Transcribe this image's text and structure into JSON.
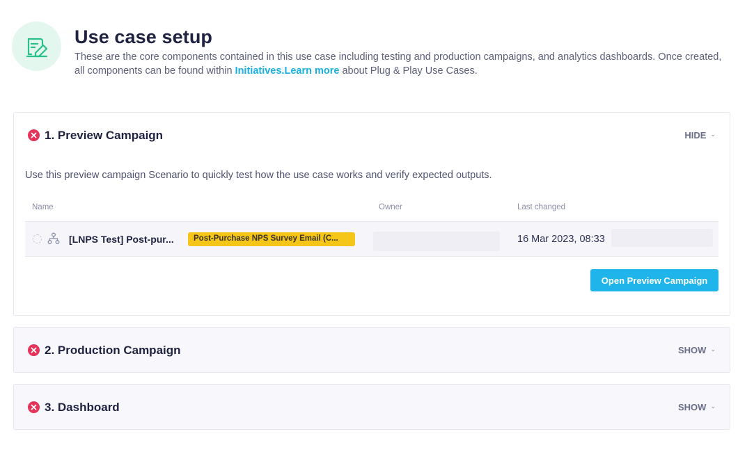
{
  "header": {
    "icon": "document-edit-icon",
    "title": "Use case setup",
    "desc_part1": "These are the core components contained in this use case including testing and production campaigns, and analytics dashboards. Once created, all components can be found within ",
    "initiatives_link": "Initiatives.",
    "learn_more_link": "Learn more",
    "desc_part2": " about Plug & Play Use Cases."
  },
  "panels": [
    {
      "title": "1. Preview Campaign",
      "toggle_label": "HIDE",
      "status_icon": "error-x-icon",
      "status_color": "#e5335a",
      "description": "Use this preview campaign Scenario to quickly test how the use case works and verify expected outputs.",
      "columns": {
        "name": "Name",
        "owner": "Owner",
        "last_changed": "Last changed"
      },
      "rows": [
        {
          "name": "[LNPS Test] Post-pur...",
          "badge": "Post-Purchase NPS Survey Email (C...",
          "owner": "",
          "last_changed": "16 Mar 2023, 08:33"
        }
      ],
      "action_label": "Open Preview Campaign"
    },
    {
      "title": "2. Production Campaign",
      "toggle_label": "SHOW",
      "status_icon": "error-x-icon"
    },
    {
      "title": "3. Dashboard",
      "toggle_label": "SHOW",
      "status_icon": "error-x-icon"
    }
  ],
  "colors": {
    "accent": "#1fb5ea",
    "link": "#1bb0e0",
    "badge": "#f5c518",
    "error": "#e5335a",
    "icon_bg": "#e3f7ef",
    "icon_stroke": "#2bbf8a"
  }
}
